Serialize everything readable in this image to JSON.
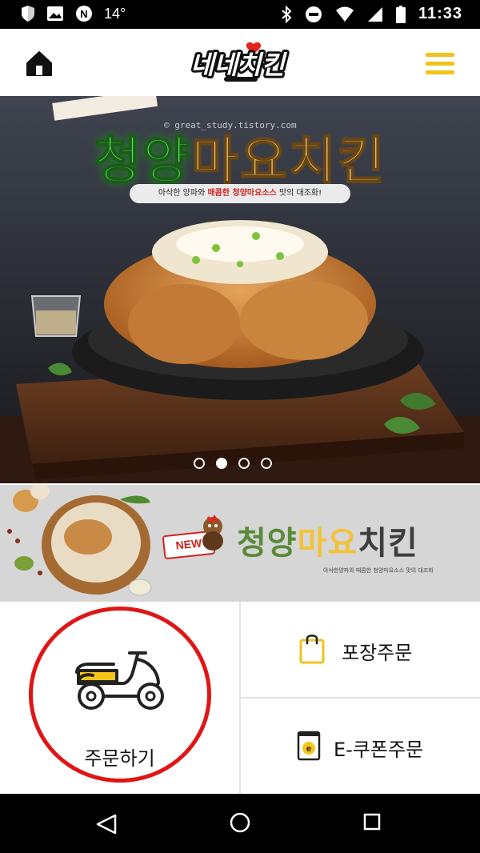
{
  "status_bar": {
    "temperature": "14°",
    "time": "11:33",
    "icons": [
      "shield-icon",
      "image-icon",
      "notification-n-icon",
      "bluetooth-icon",
      "do-not-disturb-icon",
      "wifi-icon",
      "battery-icon"
    ]
  },
  "header": {
    "brand": "네네치킨",
    "home_icon": "home-icon",
    "menu_icon": "hamburger-menu-icon",
    "accent_color": "#f1c21b"
  },
  "hero": {
    "title_green": "청양",
    "title_gold": "마요치킨",
    "subtitle_prefix": "아삭한 양파와",
    "subtitle_highlight": "매콤한 청양마요소스",
    "subtitle_suffix": "맛의 대조화!",
    "watermark": "© great_study.tistory.com",
    "pager_total": 4,
    "pager_active": 2
  },
  "promo": {
    "badge": "NEW",
    "title_green": "청양",
    "title_gold": "마요",
    "title_dark": "치킨",
    "subtitle": "아삭한양파와 매콤한 청양마요소스 맛의 대조화"
  },
  "actions": {
    "order_label": "주문하기",
    "takeout_label": "포장주문",
    "coupon_label": "E-쿠폰주문",
    "coupon_icon_letter": "e"
  },
  "annotation": {
    "color": "#e11515"
  }
}
